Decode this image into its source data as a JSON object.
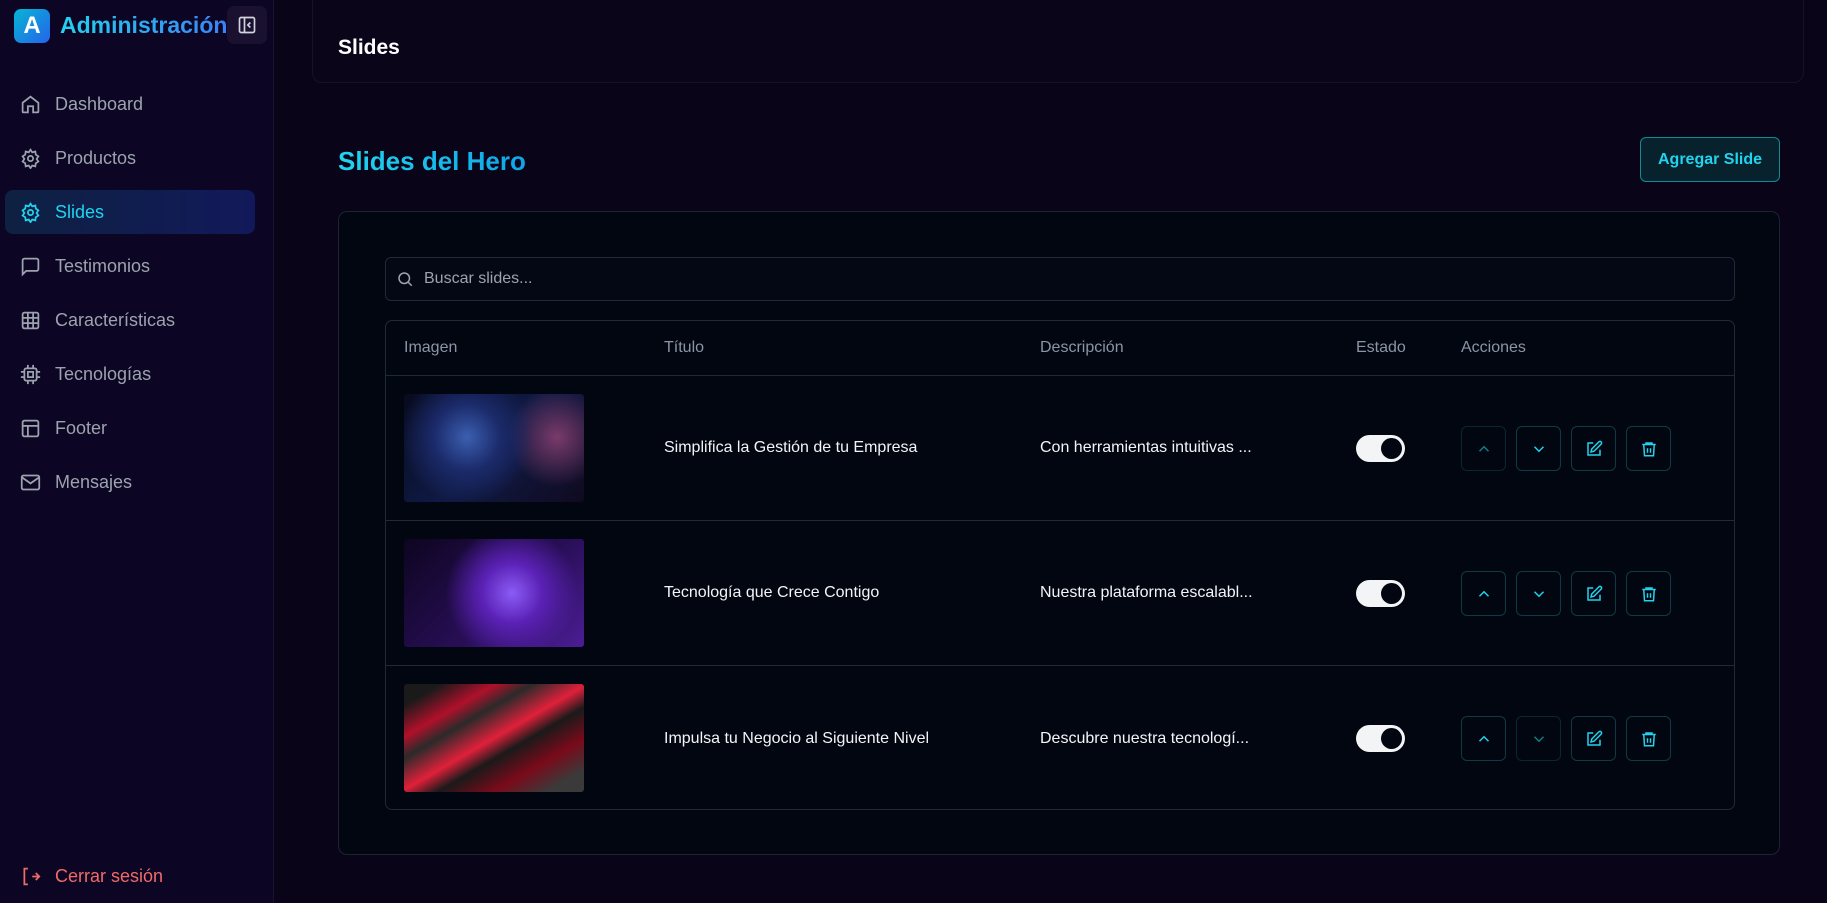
{
  "sidebar": {
    "logo_letter": "A",
    "brand": "Administración",
    "items": [
      {
        "label": "Dashboard",
        "icon": "home-icon"
      },
      {
        "label": "Productos",
        "icon": "gear-icon"
      },
      {
        "label": "Slides",
        "icon": "gear-icon",
        "active": true
      },
      {
        "label": "Testimonios",
        "icon": "message-icon"
      },
      {
        "label": "Características",
        "icon": "grid-icon"
      },
      {
        "label": "Tecnologías",
        "icon": "chip-icon"
      },
      {
        "label": "Footer",
        "icon": "layout-icon"
      },
      {
        "label": "Mensajes",
        "icon": "mail-icon"
      }
    ],
    "logout": "Cerrar sesión"
  },
  "header": {
    "title": "Slides"
  },
  "main": {
    "title": "Slides del Hero",
    "add_button": "Agregar Slide",
    "search_placeholder": "Buscar slides...",
    "columns": [
      "Imagen",
      "Título",
      "Descripción",
      "Estado",
      "Acciones"
    ],
    "rows": [
      {
        "title": "Simplifica la Gestión de tu Empresa",
        "description": "Con herramientas intuitivas ...",
        "active": true,
        "up_disabled": true,
        "down_disabled": false
      },
      {
        "title": "Tecnología que Crece Contigo",
        "description": "Nuestra plataforma escalabl...",
        "active": true,
        "up_disabled": false,
        "down_disabled": false
      },
      {
        "title": "Impulsa tu Negocio al Siguiente Nivel",
        "description": "Descubre nuestra tecnologí...",
        "active": true,
        "up_disabled": false,
        "down_disabled": true
      }
    ]
  },
  "colors": {
    "accent": "#22d3ee",
    "danger": "#f06a6a",
    "background": "#090418"
  }
}
